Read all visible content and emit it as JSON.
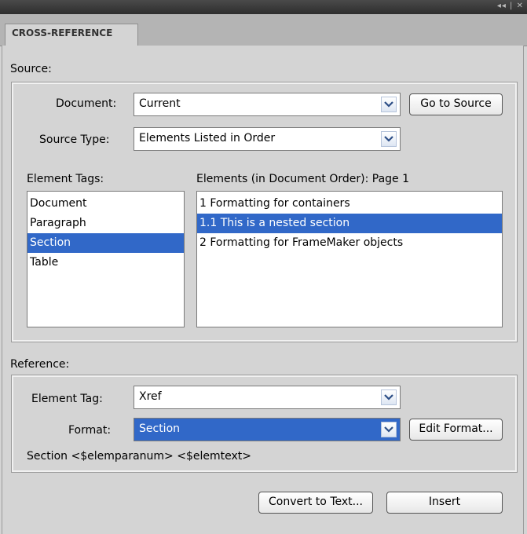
{
  "panel": {
    "controls": "◂◂ | ✕",
    "tab": "CROSS-REFERENCE"
  },
  "source": {
    "heading": "Source:",
    "document_label": "Document:",
    "document_value": "Current",
    "go_to_source": "Go to Source",
    "source_type_label": "Source Type:",
    "source_type_value": "Elements Listed in Order",
    "element_tags_label": "Element Tags:",
    "element_tags": [
      "Document",
      "Paragraph",
      "Section",
      "Table"
    ],
    "element_tags_selected": "Section",
    "elements_label": "Elements (in Document Order): Page  1",
    "elements": [
      "1 Formatting for containers",
      "1.1 This is a nested section",
      "2 Formatting for FrameMaker objects"
    ],
    "elements_selected": "1.1 This is a nested section"
  },
  "reference": {
    "heading": "Reference:",
    "element_tag_label": "Element Tag:",
    "element_tag_value": "Xref",
    "format_label": "Format:",
    "format_value": "Section",
    "edit_format": "Edit Format...",
    "format_definition": "Section <$elemparanum> <$elemtext>"
  },
  "buttons": {
    "convert": "Convert to Text...",
    "insert": "Insert"
  },
  "colors": {
    "selection": "#3168c8",
    "panel_bg": "#d4d4d4"
  }
}
